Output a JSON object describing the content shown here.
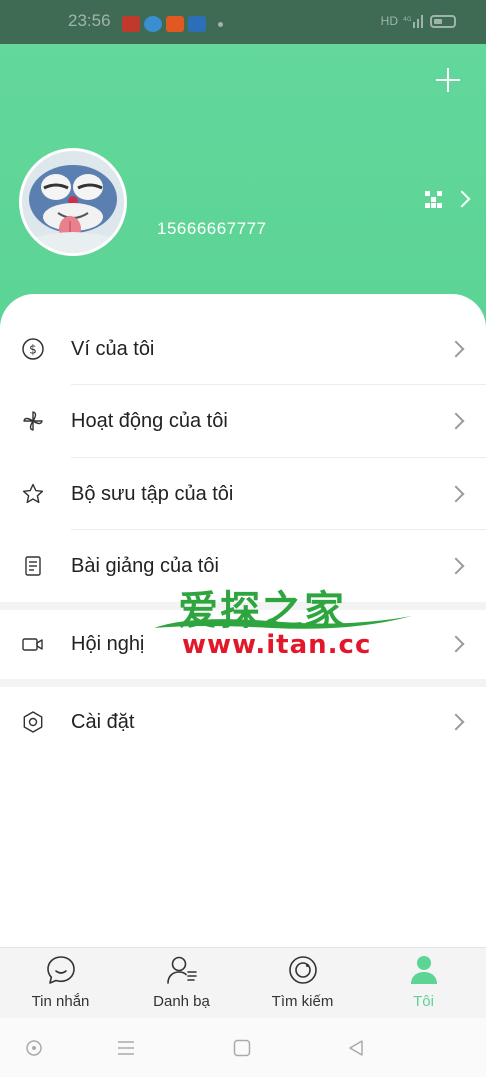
{
  "status_bar": {
    "time": "23:56",
    "network": "HD",
    "app_icon_colors": [
      "#c0392b",
      "#3a8fd0",
      "#e25822",
      "#2a6fb8"
    ]
  },
  "header": {
    "phone_number": "15666667777",
    "background_color": "#5bd494"
  },
  "menu": {
    "items": [
      {
        "label": "Ví của tôi",
        "icon": "dollar-circle-icon"
      },
      {
        "label": "Hoạt động của tôi",
        "icon": "pinwheel-icon"
      },
      {
        "label": "Bộ sưu tập của tôi",
        "icon": "star-icon"
      },
      {
        "label": "Bài giảng của tôi",
        "icon": "document-icon"
      },
      {
        "label": "Hội nghị",
        "icon": "video-camera-icon"
      },
      {
        "label": "Cài đặt",
        "icon": "hexagon-settings-icon"
      }
    ]
  },
  "watermark": {
    "title": "爱探之家",
    "url": "www.itan.cc"
  },
  "tabbar": {
    "tabs": [
      {
        "label": "Tin nhắn",
        "icon": "chat-bubble-icon",
        "active": false
      },
      {
        "label": "Danh bạ",
        "icon": "contacts-icon",
        "active": false
      },
      {
        "label": "Tìm kiếm",
        "icon": "explore-icon",
        "active": false
      },
      {
        "label": "Tôi",
        "icon": "person-icon",
        "active": true
      }
    ],
    "active_color": "#5bd494"
  }
}
